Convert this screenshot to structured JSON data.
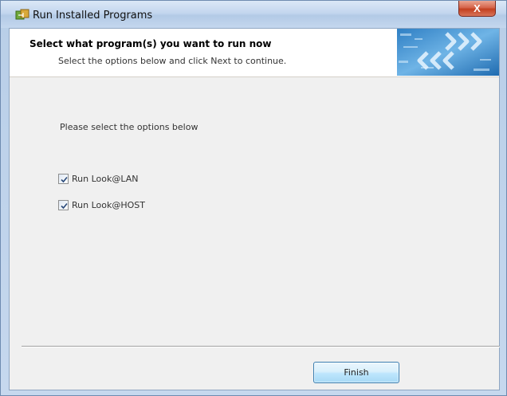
{
  "window": {
    "title": "Run Installed Programs",
    "close_label": "X"
  },
  "header": {
    "title": "Select what program(s) you want to run now",
    "subtitle": "Select the options below and click Next to continue."
  },
  "main": {
    "prompt": "Please select the options below",
    "options": [
      {
        "label": "Run Look@LAN",
        "checked": true
      },
      {
        "label": "Run Look@HOST",
        "checked": true
      }
    ]
  },
  "footer": {
    "finish_label": "Finish"
  },
  "colors": {
    "accent": "#3c7fb1",
    "header_bg": "#ffffff",
    "client_bg": "#f0f0f0"
  }
}
